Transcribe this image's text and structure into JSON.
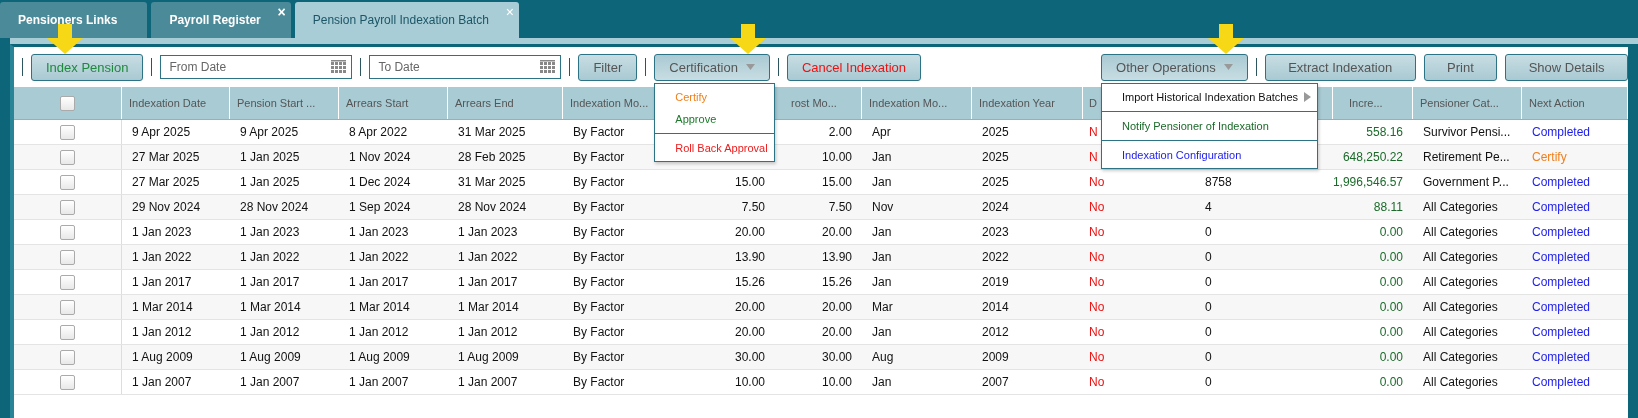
{
  "tabs": [
    {
      "label": "Pensioners Links",
      "selected": false,
      "closable": false
    },
    {
      "label": "Payroll Register",
      "selected": false,
      "closable": true
    },
    {
      "label": "Pension Payroll Indexation Batch",
      "selected": true,
      "closable": true
    }
  ],
  "close_glyph": "×",
  "toolbar": [
    {
      "kind": "separator"
    },
    {
      "kind": "button",
      "label": "Index Pension",
      "color": "#1e8a3c",
      "pointer": true
    },
    {
      "kind": "separator"
    },
    {
      "kind": "date_field",
      "placeholder": "From Date"
    },
    {
      "kind": "separator"
    },
    {
      "kind": "date_field",
      "placeholder": "To Date"
    },
    {
      "kind": "separator"
    },
    {
      "kind": "button",
      "label": "Filter",
      "color": "#555555"
    },
    {
      "kind": "separator"
    },
    {
      "kind": "dropdown",
      "label": "Certification",
      "color": "#555555",
      "pointer": true,
      "open": true,
      "menu": [
        [
          {
            "label": "Certify",
            "color": "#f07f1c",
            "submenu": false
          },
          {
            "label": "Approve",
            "color": "#1b7a2a",
            "submenu": false
          }
        ],
        [
          {
            "label": "Roll Back Approval",
            "color": "#ee1c1c",
            "submenu": false
          }
        ]
      ]
    },
    {
      "kind": "separator"
    },
    {
      "kind": "button",
      "label": "Cancel Indexation",
      "color": "#ee1111"
    },
    {
      "kind": "spacer"
    },
    {
      "kind": "dropdown",
      "label": "Other Operations",
      "color": "#555555",
      "pointer": true,
      "open": true,
      "menu": [
        [
          {
            "label": "Import Historical Indexation Batches",
            "color": "#111111",
            "submenu": true
          }
        ],
        [
          {
            "label": "Notify Pensioner of Indexation",
            "color": "#1b6a2a",
            "submenu": false
          }
        ],
        [
          {
            "label": "Indexation Configuration",
            "color": "#1c1cee",
            "submenu": false
          }
        ]
      ]
    },
    {
      "kind": "separator"
    },
    {
      "kind": "button",
      "label": "Extract Indexation",
      "color": "#555555"
    },
    {
      "kind": "button",
      "label": "Print",
      "color": "#555555"
    },
    {
      "kind": "button",
      "label": "Show Details",
      "color": "#555555"
    }
  ],
  "table": {
    "header_checked": false,
    "columns": [
      {
        "label": "Indexation Date",
        "kind": "text"
      },
      {
        "label": "Pension Start ...",
        "kind": "text"
      },
      {
        "label": "Arrears Start",
        "kind": "text"
      },
      {
        "label": "Arrears End",
        "kind": "text"
      },
      {
        "label": "Indexation Mo...",
        "kind": "text"
      },
      {
        "kind": "number"
      },
      {
        "label": "rost Mo...",
        "kind": "number"
      },
      {
        "label": "Indexation Mo...",
        "kind": "text"
      },
      {
        "label": "Indexation Year",
        "kind": "text"
      },
      {
        "label": "D",
        "kind": "flag"
      },
      {
        "kind": "text"
      },
      {
        "label": "Incre...",
        "kind": "amount"
      },
      {
        "label": "Pensioner Cat...",
        "kind": "text"
      },
      {
        "label": "Next Action",
        "kind": "action"
      }
    ],
    "rows": [
      {
        "selected": false,
        "color": "#1c1cee",
        "cells": [
          "9 Apr 2025",
          "9 Apr 2025",
          "8 Apr 2022",
          "31 Mar 2025",
          "By Factor",
          null,
          "2.00",
          "Apr",
          "2025",
          "N",
          null,
          "558.16",
          "Survivor Pensi...",
          "Completed"
        ]
      },
      {
        "selected": false,
        "color": "#f07f1c",
        "cells": [
          "27 Mar 2025",
          "1 Jan 2025",
          "1 Nov 2024",
          "28 Feb 2025",
          "By Factor",
          null,
          "10.00",
          "Jan",
          "2025",
          "N",
          null,
          "648,250.22",
          "Retirement Pe...",
          "Certify"
        ]
      },
      {
        "selected": false,
        "color": "#1c1cee",
        "cells": [
          "27 Mar 2025",
          "1 Jan 2025",
          "1 Dec 2024",
          "31 Mar 2025",
          "By Factor",
          "15.00",
          "15.00",
          "Jan",
          "2025",
          "No",
          "8758",
          "1,996,546.57",
          "Government P...",
          "Completed"
        ]
      },
      {
        "selected": false,
        "color": "#1c1cee",
        "cells": [
          "29 Nov 2024",
          "28 Nov 2024",
          "1 Sep 2024",
          "28 Nov 2024",
          "By Factor",
          "7.50",
          "7.50",
          "Nov",
          "2024",
          "No",
          "4",
          "88.11",
          "All Categories",
          "Completed"
        ]
      },
      {
        "selected": false,
        "color": "#1c1cee",
        "cells": [
          "1 Jan 2023",
          "1 Jan 2023",
          "1 Jan 2023",
          "1 Jan 2023",
          "By Factor",
          "20.00",
          "20.00",
          "Jan",
          "2023",
          "No",
          "0",
          "0.00",
          "All Categories",
          "Completed"
        ]
      },
      {
        "selected": false,
        "color": "#1c1cee",
        "cells": [
          "1 Jan 2022",
          "1 Jan 2022",
          "1 Jan 2022",
          "1 Jan 2022",
          "By Factor",
          "13.90",
          "13.90",
          "Jan",
          "2022",
          "No",
          "0",
          "0.00",
          "All Categories",
          "Completed"
        ]
      },
      {
        "selected": false,
        "color": "#1c1cee",
        "cells": [
          "1 Jan 2017",
          "1 Jan 2017",
          "1 Jan 2017",
          "1 Jan 2017",
          "By Factor",
          "15.26",
          "15.26",
          "Jan",
          "2019",
          "No",
          "0",
          "0.00",
          "All Categories",
          "Completed"
        ]
      },
      {
        "selected": false,
        "color": "#1c1cee",
        "cells": [
          "1 Mar 2014",
          "1 Mar 2014",
          "1 Mar 2014",
          "1 Mar 2014",
          "By Factor",
          "20.00",
          "20.00",
          "Mar",
          "2014",
          "No",
          "0",
          "0.00",
          "All Categories",
          "Completed"
        ]
      },
      {
        "selected": false,
        "color": "#1c1cee",
        "cells": [
          "1 Jan 2012",
          "1 Jan 2012",
          "1 Jan 2012",
          "1 Jan 2012",
          "By Factor",
          "20.00",
          "20.00",
          "Jan",
          "2012",
          "No",
          "0",
          "0.00",
          "All Categories",
          "Completed"
        ]
      },
      {
        "selected": false,
        "color": "#1c1cee",
        "cells": [
          "1 Aug 2009",
          "1 Aug 2009",
          "1 Aug 2009",
          "1 Aug 2009",
          "By Factor",
          "30.00",
          "30.00",
          "Aug",
          "2009",
          "No",
          "0",
          "0.00",
          "All Categories",
          "Completed"
        ]
      },
      {
        "selected": false,
        "color": "#1c1cee",
        "cells": [
          "1 Jan 2007",
          "1 Jan 2007",
          "1 Jan 2007",
          "1 Jan 2007",
          "By Factor",
          "10.00",
          "10.00",
          "Jan",
          "2007",
          "No",
          "0",
          "0.00",
          "All Categories",
          "Completed"
        ]
      }
    ]
  }
}
